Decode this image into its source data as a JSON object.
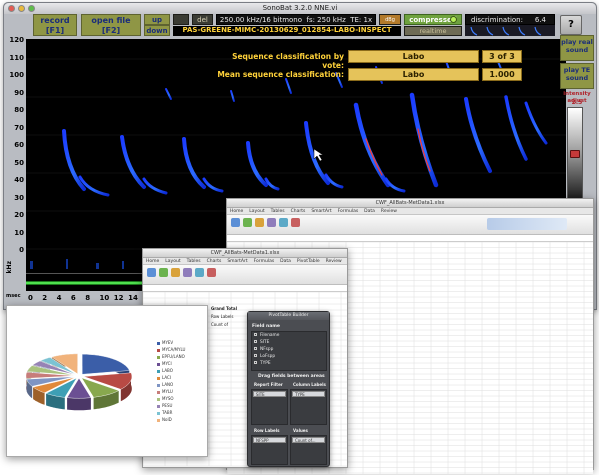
{
  "window": {
    "title": "SonoBat 3.2.0 NNE.vi"
  },
  "toolbar": {
    "record_label": "record",
    "record_key": "[F1]",
    "open_file_label": "open file",
    "open_file_key": "[F2]",
    "up_label": "up",
    "down_label": "down",
    "del_label": "del",
    "sampling_info": "250.00 kHz/16 bitmono",
    "fs_info": "fs: 250 kHz",
    "te_info": "TE: 1x",
    "compressed_label": "compressed",
    "realtime_label": "realtime",
    "discrimination_label": "discrimination:",
    "discrimination_value": "6.4",
    "help_label": "?",
    "file_name": "PAS-GREENE-MIMC-20130629_012854-LABO-INSPECT"
  },
  "classification": {
    "vote_label": "Sequence classification by vote:",
    "vote_species": "Labo",
    "vote_count": "3 of 3",
    "mean_label": "Mean sequence classification:",
    "mean_species": "Labo",
    "mean_value": "1.000"
  },
  "side_panel": {
    "play_real_label": "play real sound",
    "play_te_label": "play TE sound",
    "intensity_label": "intensity adjust",
    "intensity_value": "2.5"
  },
  "axis": {
    "y_ticks": [
      "120",
      "110",
      "100",
      "90",
      "80",
      "70",
      "60",
      "50",
      "40",
      "30",
      "20",
      "10",
      "0"
    ],
    "y_unit": "kHz",
    "x_ticks": [
      "0",
      "2",
      "4",
      "6",
      "8",
      "10",
      "12",
      "14",
      "16",
      "18"
    ],
    "x_unit": "msec"
  },
  "excel_back": {
    "title": "CWF_AllBats-MetData1.xlsx",
    "tabs": [
      "Home",
      "Layout",
      "Tables",
      "Charts",
      "SmartArt",
      "Formulas",
      "Data",
      "Review"
    ]
  },
  "excel_front": {
    "title": "CWF_AllBats-MetData1.xlsx",
    "tabs": [
      "Home",
      "Layout",
      "Tables",
      "Charts",
      "SmartArt",
      "Formulas",
      "Data",
      "PivotTable",
      "Review"
    ],
    "sheet_values": [
      "Grand Total",
      "Row Labels",
      "Count of"
    ]
  },
  "pivot_builder": {
    "title": "PivotTable Builder",
    "field_name_label": "Field name",
    "fields": [
      "Filename",
      "SITE",
      "NFspp",
      "LoFspp",
      "TYPE"
    ],
    "drag_label": "Drag fields between areas",
    "report_filter_label": "Report Filter",
    "column_labels_label": "Column Labels",
    "report_filter_value": "SITE",
    "column_labels_value": "TYPE",
    "row_labels_label": "Row Labels",
    "values_label": "Values",
    "row_labels_value": "NFSPP",
    "values_value": "Count of..."
  },
  "pie_chart": {
    "legend": [
      "MYEV",
      "MYCA/MYLU",
      "EPFU/LANO",
      "MYCI",
      "LABO",
      "LACI",
      "LANO",
      "MYLU",
      "MYSO",
      "PESU",
      "TABR",
      "NoID"
    ],
    "colors": [
      "#3b5ea8",
      "#b84a44",
      "#88a84e",
      "#6b4f93",
      "#3e9fb5",
      "#e0893a",
      "#7f95c4",
      "#c77d7a",
      "#a9c27e",
      "#9683b5",
      "#7cc3d3",
      "#f1b37c"
    ]
  },
  "chart_data": {
    "type": "pie",
    "categories": [
      "MYEV",
      "MYCA/MYLU",
      "EPFU/LANO",
      "MYCI",
      "LABO",
      "LACI",
      "LANO",
      "MYLU",
      "MYSO",
      "PESU",
      "TABR",
      "NoID"
    ],
    "values": [
      22,
      14,
      10,
      8,
      7,
      6,
      6,
      5,
      5,
      4,
      4,
      9
    ]
  }
}
